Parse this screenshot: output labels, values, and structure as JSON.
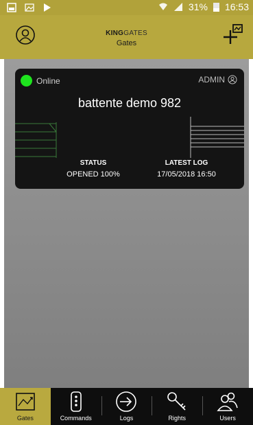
{
  "status_bar": {
    "battery_percent": "31%",
    "time": "16:53",
    "left_icons": [
      "gallery-icon",
      "image-icon",
      "play-store-icon"
    ],
    "right_icons": [
      "wifi-icon",
      "signal-icon",
      "battery-icon"
    ]
  },
  "header": {
    "logo_bold": "KING",
    "logo_light": "GATES",
    "title": "Gates",
    "left_icon": "profile-icon",
    "right_icon": "add-gate-icon"
  },
  "gate_card": {
    "connection_status": "Online",
    "role": "ADMIN",
    "name": "battente demo 982",
    "status_label": "STATUS",
    "status_value": "OPENED 100%",
    "log_label": "LATEST LOG",
    "log_value": "17/05/2018 16:50",
    "online_color": "#1ee41e",
    "gate_line_color": "#3a7a3a"
  },
  "nav": {
    "items": [
      {
        "label": "Gates",
        "icon": "gates-icon",
        "active": true
      },
      {
        "label": "Commands",
        "icon": "remote-control-icon",
        "active": false
      },
      {
        "label": "Logs",
        "icon": "logs-arrow-icon",
        "active": false
      },
      {
        "label": "Rights",
        "icon": "key-icon",
        "active": false
      },
      {
        "label": "Users",
        "icon": "users-icon",
        "active": false
      }
    ]
  },
  "colors": {
    "header_bg": "#b7a83e",
    "status_bar_bg": "#b1a23a",
    "nav_active_bg": "#b9a93f",
    "card_bg": "#141414"
  }
}
